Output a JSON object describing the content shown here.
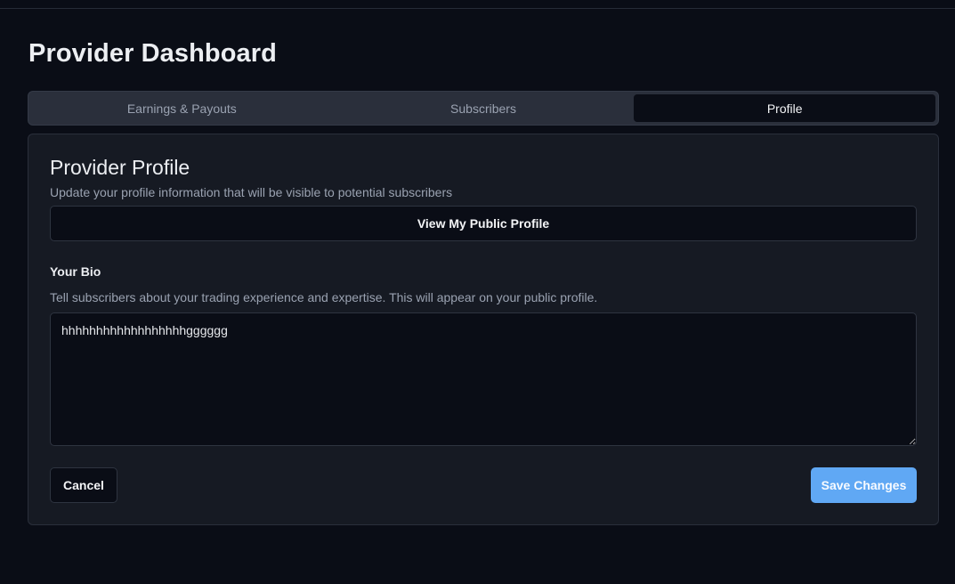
{
  "page": {
    "title": "Provider Dashboard"
  },
  "tabs": [
    {
      "label": "Earnings & Payouts",
      "active": false
    },
    {
      "label": "Subscribers",
      "active": false
    },
    {
      "label": "Profile",
      "active": true
    }
  ],
  "profile": {
    "title": "Provider Profile",
    "subtitle": "Update your profile information that will be visible to potential subscribers",
    "public_profile_button": "View My Public Profile",
    "bio_label": "Your Bio",
    "bio_help": "Tell subscribers about your trading experience and expertise. This will appear on your public profile.",
    "bio_value": "hhhhhhhhhhhhhhhhhhgggggg",
    "cancel_label": "Cancel",
    "save_label": "Save Changes"
  },
  "colors": {
    "background": "#0a0d16",
    "card": "#161a23",
    "accent": "#60a8f4"
  }
}
